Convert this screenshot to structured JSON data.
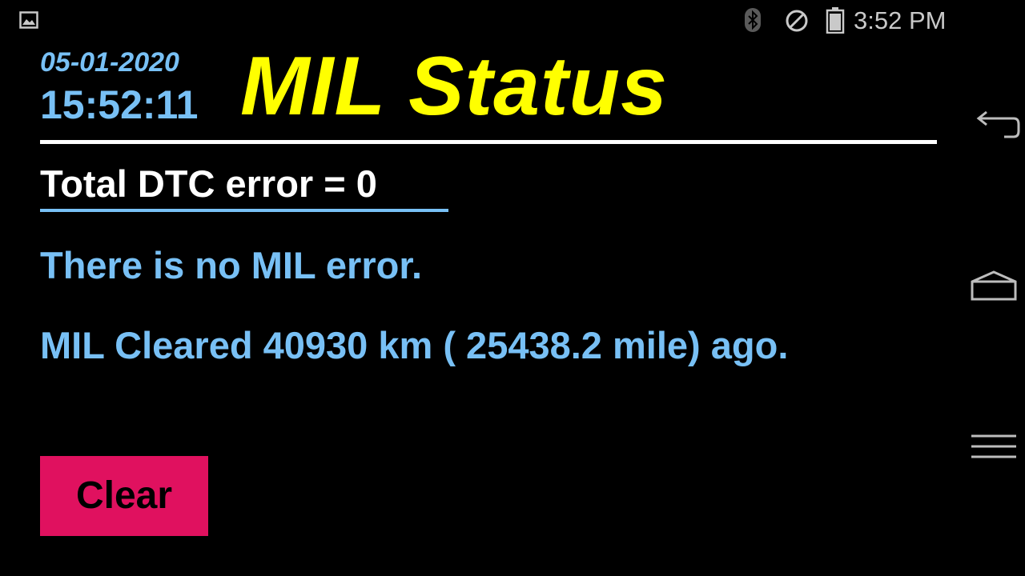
{
  "status_bar": {
    "clock": "3:52 PM",
    "icons": [
      "gallery-icon",
      "bluetooth-icon",
      "do-not-disturb-icon",
      "battery-icon"
    ]
  },
  "nav_bar": {
    "icons": [
      "back-icon",
      "home-icon",
      "menu-icon"
    ]
  },
  "header": {
    "date": "05-01-2020",
    "time": "15:52:11",
    "title": "MIL Status"
  },
  "main": {
    "dtc_total": "Total DTC error = 0",
    "mil_message": "There is no MIL error.",
    "mil_cleared": "MIL Cleared 40930 km ( 25438.2 mile) ago.",
    "clear_label": "Clear"
  },
  "colors": {
    "background": "#000000",
    "title": "#ffff00",
    "accent_blue": "#78c0f5",
    "button": "#e0115f",
    "text": "#ffffff"
  }
}
